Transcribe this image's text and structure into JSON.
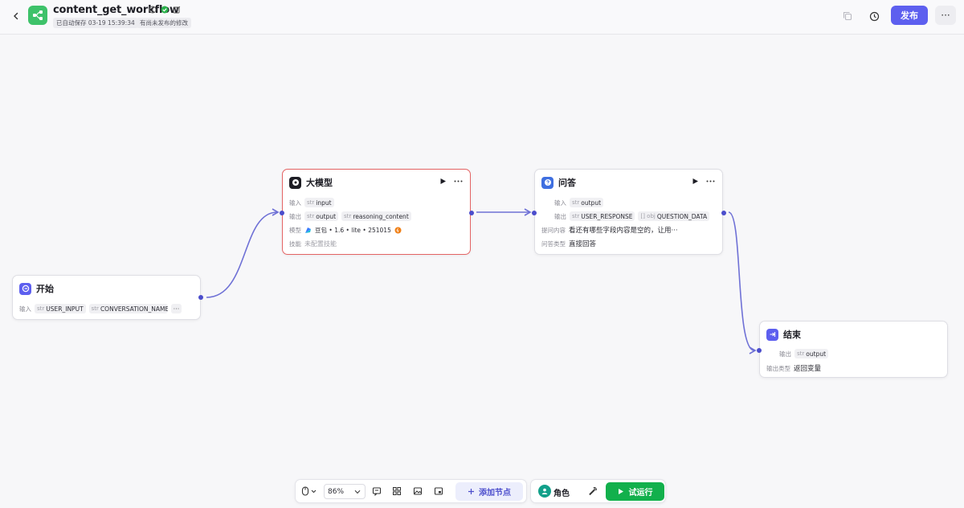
{
  "header": {
    "title": "content_get_workflow",
    "autosave": "已自动保存 03-19 15:39:34",
    "unpublished": "有尚未发布的修改",
    "publish_label": "发布",
    "more_label": "···"
  },
  "nodes": {
    "start": {
      "title": "开始",
      "input_label": "输入",
      "inputs": [
        {
          "type": "str",
          "name": "USER_INPUT"
        },
        {
          "type": "str",
          "name": "CONVERSATION_NAME"
        }
      ],
      "more": "···"
    },
    "llm": {
      "title": "大模型",
      "input_label": "输入",
      "input": {
        "type": "str",
        "name": "input"
      },
      "output_label": "输出",
      "outputs": [
        {
          "type": "str",
          "name": "output"
        },
        {
          "type": "str",
          "name": "reasoning_content"
        }
      ],
      "model_label": "模型",
      "model_value": "豆包 • 1.6 • lite • 251015",
      "skill_label": "技能",
      "skill_value": "未配置技能"
    },
    "qa": {
      "title": "问答",
      "input_label": "输入",
      "input": {
        "type": "str",
        "name": "output"
      },
      "output_label": "输出",
      "outputs": [
        {
          "type": "str",
          "name": "USER_RESPONSE"
        },
        {
          "type": "[] obj",
          "name": "QUESTION_DATA"
        }
      ],
      "question_label": "提问内容",
      "question_value": "看还有哪些字段内容是空的，让用···",
      "answer_type_label": "问答类型",
      "answer_type_value": "直接回答"
    },
    "end": {
      "title": "结束",
      "output_label": "输出",
      "output": {
        "type": "str",
        "name": "output"
      },
      "output_type_label": "输出类型",
      "output_type_value": "返回变量"
    }
  },
  "toolbar": {
    "zoom": "86%",
    "add_node_label": "添加节点",
    "role_label": "角色",
    "run_label": "试运行"
  },
  "colors": {
    "accent": "#5d5fef",
    "edge": "#6f71d6",
    "run": "#12b04c",
    "selected_border": "#e46464",
    "app_icon": "#3ec26a"
  }
}
